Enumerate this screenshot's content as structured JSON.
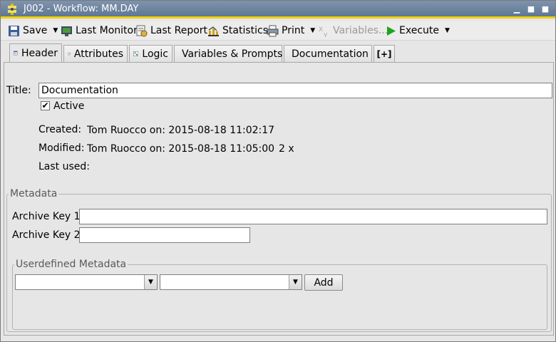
{
  "window": {
    "title": "J002 - Workflow: MM.DAY"
  },
  "toolbar": {
    "save": "Save",
    "last_monitor": "Last Monitor",
    "last_report": "Last Report",
    "statistics": "Statistics",
    "print": "Print",
    "variables": "Variables...",
    "execute": "Execute"
  },
  "tabs": [
    "Header",
    "Attributes",
    "Logic",
    "Variables & Prompts",
    "Documentation",
    "[+]"
  ],
  "header": {
    "title_label": "Title:",
    "title_value": "Documentation",
    "active_label": "Active",
    "active_checked": true,
    "created_label": "Created:",
    "created_value": "Tom Ruocco on: 2015-08-18 11:02:17",
    "modified_label": "Modified:",
    "modified_value": "Tom Ruocco on: 2015-08-18 11:05:00",
    "modified_count": "2 x",
    "last_used_label": "Last used:",
    "last_used_value": ""
  },
  "metadata": {
    "legend": "Metadata",
    "archive_key_1_label": "Archive Key 1:",
    "archive_key_1_value": "",
    "archive_key_2_label": "Archive Key 2:",
    "archive_key_2_value": ""
  },
  "userdefined": {
    "legend": "Userdefined Metadata",
    "key_value": "",
    "val_value": "",
    "add_label": "Add"
  },
  "colors": {
    "titlebar": "#6a82a0",
    "title_accent": "#f0d000",
    "execute_green": "#1da51d"
  }
}
